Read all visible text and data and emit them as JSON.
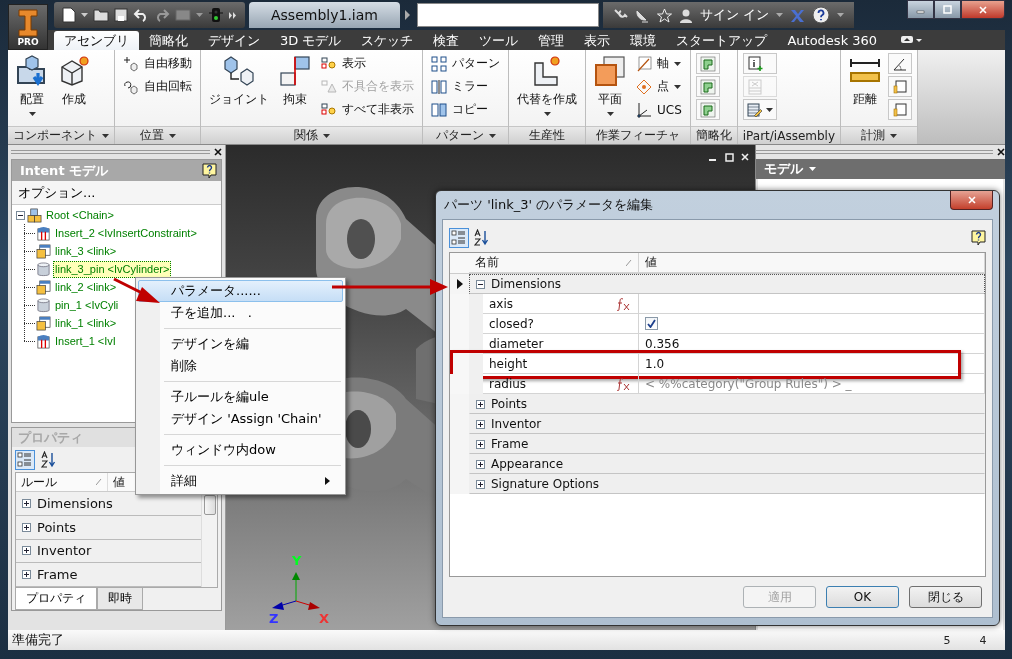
{
  "window": {
    "edition": "PRO",
    "document_title": "Assembly1.iam",
    "sign_in": "サイン イン"
  },
  "ribbon_tabs": [
    {
      "label": "アセンブリ",
      "selected": true
    },
    {
      "label": "簡略化",
      "selected": false
    },
    {
      "label": "デザイン",
      "selected": false
    },
    {
      "label": "3D モデル",
      "selected": false
    },
    {
      "label": "スケッチ",
      "selected": false
    },
    {
      "label": "検査",
      "selected": false
    },
    {
      "label": "ツール",
      "selected": false
    },
    {
      "label": "管理",
      "selected": false
    },
    {
      "label": "表示",
      "selected": false
    },
    {
      "label": "環境",
      "selected": false
    },
    {
      "label": "スタートアップ",
      "selected": false
    },
    {
      "label": "Autodesk 360",
      "selected": false
    }
  ],
  "ribbon_panels": [
    {
      "title": "コンポーネント",
      "menu": true,
      "buttons": [
        {
          "kind": "large",
          "label": "配置",
          "dropdown": true,
          "disabled": false
        },
        {
          "kind": "large",
          "label": "作成",
          "dropdown": false,
          "disabled": false
        }
      ]
    },
    {
      "title": "位置",
      "menu": true,
      "buttons": [
        {
          "kind": "small",
          "label": "自由移動",
          "dropdown": false,
          "disabled": false
        },
        {
          "kind": "small",
          "label": "自由回転",
          "dropdown": false,
          "disabled": false
        }
      ]
    },
    {
      "title": "関係",
      "menu": true,
      "buttons": [
        {
          "kind": "large",
          "label": "ジョイント",
          "dropdown": false,
          "disabled": false
        },
        {
          "kind": "large",
          "label": "拘束",
          "dropdown": false,
          "disabled": false
        },
        {
          "kind": "small",
          "label": "表示",
          "dropdown": false,
          "disabled": false
        },
        {
          "kind": "small",
          "label": "不具合を表示",
          "dropdown": false,
          "disabled": true
        },
        {
          "kind": "small",
          "label": "すべて非表示",
          "dropdown": false,
          "disabled": false
        }
      ]
    },
    {
      "title": "パターン",
      "menu": true,
      "buttons": [
        {
          "kind": "small",
          "label": "パターン",
          "dropdown": false,
          "disabled": false
        },
        {
          "kind": "small",
          "label": "ミラー",
          "dropdown": false,
          "disabled": false
        },
        {
          "kind": "small",
          "label": "コピー",
          "dropdown": false,
          "disabled": false
        }
      ]
    },
    {
      "title": "生産性",
      "menu": false,
      "buttons": [
        {
          "kind": "large",
          "label": "代替を作成",
          "dropdown": true,
          "disabled": false
        }
      ]
    },
    {
      "title": "作業フィーチャ",
      "menu": false,
      "buttons": [
        {
          "kind": "large",
          "label": "平面",
          "dropdown": true,
          "disabled": false
        },
        {
          "kind": "small",
          "label": "軸",
          "dropdown": true,
          "disabled": false
        },
        {
          "kind": "small",
          "label": "点",
          "dropdown": true,
          "disabled": false
        },
        {
          "kind": "small",
          "label": "UCS",
          "dropdown": false,
          "disabled": false
        }
      ]
    },
    {
      "title": "簡略化",
      "menu": false,
      "buttons": [
        {
          "kind": "icon",
          "dropdown": false,
          "disabled": false
        },
        {
          "kind": "icon",
          "dropdown": false,
          "disabled": false
        },
        {
          "kind": "icon",
          "dropdown": false,
          "disabled": false
        }
      ]
    },
    {
      "title": "iPart/iAssembly",
      "menu": false,
      "buttons": [
        {
          "kind": "icon",
          "dropdown": false,
          "disabled": false
        },
        {
          "kind": "icon",
          "dropdown": false,
          "disabled": true
        },
        {
          "kind": "icon",
          "dropdown": true,
          "disabled": false
        }
      ]
    },
    {
      "title": "計測",
      "menu": true,
      "buttons": [
        {
          "kind": "large",
          "label": "距離",
          "dropdown": false,
          "disabled": false
        },
        {
          "kind": "icon",
          "dropdown": false,
          "disabled": false
        },
        {
          "kind": "icon",
          "dropdown": false,
          "disabled": false
        },
        {
          "kind": "icon",
          "dropdown": false,
          "disabled": false
        }
      ]
    }
  ],
  "intent_panel": {
    "title": "Intent モデル",
    "options": "オプション...",
    "tree": [
      {
        "label": "Root <Chain>",
        "kind": "assembly",
        "expanded": true,
        "selected": false,
        "children": [
          {
            "label": "Insert_2 <IvInsertConstraint>",
            "kind": "constraint",
            "selected": false
          },
          {
            "label": "link_3 <link>",
            "kind": "part",
            "selected": false
          },
          {
            "label": "link_3_pin <IvCylinder>",
            "kind": "cylinder",
            "selected": true
          },
          {
            "label": "link_2 <link>",
            "kind": "part",
            "selected": false
          },
          {
            "label": "pin_1 <IvCyli",
            "kind": "cylinder",
            "selected": false
          },
          {
            "label": "link_1 <link>",
            "kind": "part",
            "selected": false
          },
          {
            "label": "Insert_1 <IvI",
            "kind": "constraint",
            "selected": false
          }
        ]
      }
    ]
  },
  "properties_panel": {
    "title": "プロパティ",
    "columns": [
      "ルール",
      "値"
    ],
    "groups": [
      {
        "label": "Dimensions",
        "expanded": false
      },
      {
        "label": "Points",
        "expanded": false
      },
      {
        "label": "Inventor",
        "expanded": false
      },
      {
        "label": "Frame",
        "expanded": false
      }
    ],
    "tabs": [
      {
        "label": "プロパティ",
        "selected": true
      },
      {
        "label": "即時",
        "selected": false
      }
    ]
  },
  "model_panel": {
    "title": "モデル"
  },
  "viewport": {
    "axis_labels": {
      "y": "Y",
      "z": "Z",
      "x": "X"
    }
  },
  "status_bar": {
    "text": "準備完了",
    "counts": [
      "5",
      "4"
    ]
  },
  "context_menu": {
    "sections": [
      {
        "items": [
          {
            "label": "パラメータ......",
            "selected": true,
            "submenu": false
          },
          {
            "label": "子を追加...   .",
            "selected": false,
            "submenu": false
          }
        ]
      },
      {
        "items": [
          {
            "label": "デザインを編",
            "selected": false,
            "submenu": false
          },
          {
            "label": "削除",
            "selected": false,
            "submenu": false
          }
        ]
      },
      {
        "items": [
          {
            "label": "子ルールを編ule",
            "selected": false,
            "submenu": false
          },
          {
            "label": "デザイン 'Assign 'Chain'",
            "selected": false,
            "submenu": false
          }
        ]
      },
      {
        "items": [
          {
            "label": "ウィンドウ内dow",
            "selected": false,
            "submenu": false
          }
        ]
      },
      {
        "items": [
          {
            "label": "詳細",
            "selected": false,
            "submenu": true
          }
        ]
      }
    ]
  },
  "dialog": {
    "title": "パーツ 'link_3' のパラメータを編集",
    "columns": [
      "名前",
      "値"
    ],
    "groups": [
      {
        "label": "Dimensions",
        "expanded": true,
        "current": true,
        "rows": [
          {
            "name": "axis",
            "kind": "formula",
            "highlighted": false
          },
          {
            "name": "closed?",
            "kind": "boolean",
            "checked": true,
            "highlighted": false
          },
          {
            "name": "diameter",
            "kind": "text",
            "value": "0.356",
            "highlighted": false
          },
          {
            "name": "height",
            "kind": "text",
            "value": "1.0",
            "highlighted": true
          },
          {
            "name": "radius",
            "kind": "formula",
            "value": "< %%category(\"Group Rules\") > _",
            "highlighted": false
          }
        ]
      },
      {
        "label": "Points",
        "expanded": false,
        "current": false
      },
      {
        "label": "Inventor",
        "expanded": false,
        "current": false
      },
      {
        "label": "Frame",
        "expanded": false,
        "current": false
      },
      {
        "label": "Appearance",
        "expanded": false,
        "current": false
      },
      {
        "label": "Signature Options",
        "expanded": false,
        "current": false
      }
    ],
    "buttons": [
      {
        "label": "適用",
        "disabled": true,
        "default": false
      },
      {
        "label": "OK",
        "disabled": false,
        "default": true
      },
      {
        "label": "閉じる",
        "disabled": false,
        "default": false
      }
    ]
  }
}
